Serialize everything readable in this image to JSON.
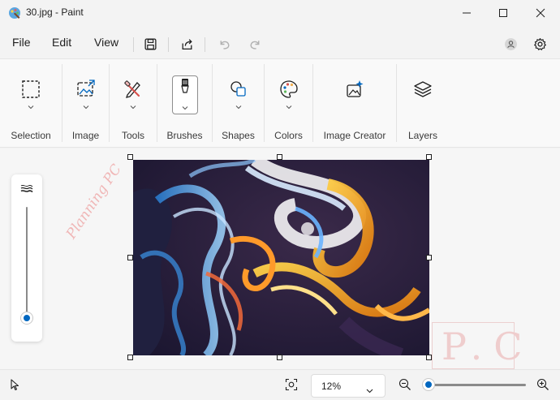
{
  "window": {
    "title": "30.jpg - Paint",
    "icon": "paint-palette-icon"
  },
  "menu": {
    "file": "File",
    "edit": "Edit",
    "view": "View"
  },
  "ribbon": {
    "groups": [
      {
        "label": "Selection",
        "icon": "selection-icon"
      },
      {
        "label": "Image",
        "icon": "image-icon"
      },
      {
        "label": "Tools",
        "icon": "tools-icon"
      },
      {
        "label": "Brushes",
        "icon": "brush-icon"
      },
      {
        "label": "Shapes",
        "icon": "shapes-icon"
      },
      {
        "label": "Colors",
        "icon": "palette-icon"
      },
      {
        "label": "Image Creator",
        "icon": "image-creator-icon"
      },
      {
        "label": "Layers",
        "icon": "layers-icon"
      }
    ]
  },
  "canvas": {
    "image_name": "30.jpg"
  },
  "brush_size": {
    "level": 0.02
  },
  "status": {
    "zoom_label": "12%",
    "zoom_level": 0.12
  },
  "watermark": {
    "diagonal": "Planning PC",
    "logo": "P.C"
  },
  "colors": {
    "accent": "#0067c0",
    "background": "#f3f3f3"
  }
}
